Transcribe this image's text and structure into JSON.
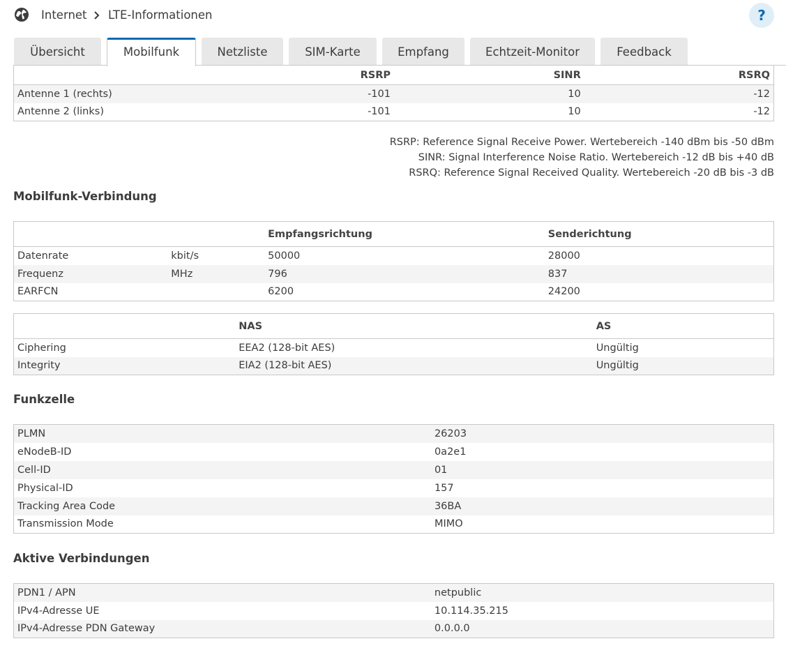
{
  "breadcrumb": {
    "root": "Internet",
    "current": "LTE-Informationen"
  },
  "help_label": "?",
  "tabs": [
    "Übersicht",
    "Mobilfunk",
    "Netzliste",
    "SIM-Karte",
    "Empfang",
    "Echtzeit-Monitor",
    "Feedback"
  ],
  "active_tab": "Mobilfunk",
  "antenna": {
    "headers": [
      "",
      "RSRP",
      "SINR",
      "RSRQ"
    ],
    "rows": [
      [
        "Antenne 1 (rechts)",
        "-101",
        "10",
        "-12"
      ],
      [
        "Antenne 2 (links)",
        "-101",
        "10",
        "-12"
      ]
    ]
  },
  "notes": [
    "RSRP: Reference Signal Receive Power. Wertebereich -140 dBm bis -50 dBm",
    "SINR: Signal Interference Noise Ratio. Wertebereich -12 dB bis +40 dB",
    "RSRQ: Reference Signal Received Quality. Wertebereich -20 dB bis -3 dB"
  ],
  "mobile_connection": {
    "title": "Mobilfunk-Verbindung",
    "headers": [
      "",
      "",
      "Empfangsrichtung",
      "Senderichtung"
    ],
    "rows": [
      [
        "Datenrate",
        "kbit/s",
        "50000",
        "28000"
      ],
      [
        "Frequenz",
        "MHz",
        "796",
        "837"
      ],
      [
        "EARFCN",
        "",
        "6200",
        "24200"
      ]
    ]
  },
  "security": {
    "headers": [
      "",
      "NAS",
      "AS"
    ],
    "rows": [
      [
        "Ciphering",
        "EEA2 (128-bit AES)",
        "Ungültig"
      ],
      [
        "Integrity",
        "EIA2 (128-bit AES)",
        "Ungültig"
      ]
    ]
  },
  "cell": {
    "title": "Funkzelle",
    "rows": [
      [
        "PLMN",
        "26203"
      ],
      [
        "eNodeB-ID",
        "0a2e1"
      ],
      [
        "Cell-ID",
        "01"
      ],
      [
        "Physical-ID",
        "157"
      ],
      [
        "Tracking Area Code",
        "36BA"
      ],
      [
        "Transmission Mode",
        "MIMO"
      ]
    ]
  },
  "active_connections": {
    "title": "Aktive Verbindungen",
    "rows": [
      [
        "PDN1 / APN",
        "netpublic"
      ],
      [
        "IPv4-Adresse UE",
        "10.114.35.215"
      ],
      [
        "IPv4-Adresse PDN Gateway",
        "0.0.0.0"
      ]
    ]
  },
  "colors": {
    "accent": "#0e6aae",
    "tab_bg": "#e8e8e8",
    "row_alt": "#f4f4f4",
    "border": "#c8c8c8"
  },
  "icons": {
    "globe": "globe-icon",
    "separator": "chevron-right-icon",
    "help": "help-icon"
  }
}
